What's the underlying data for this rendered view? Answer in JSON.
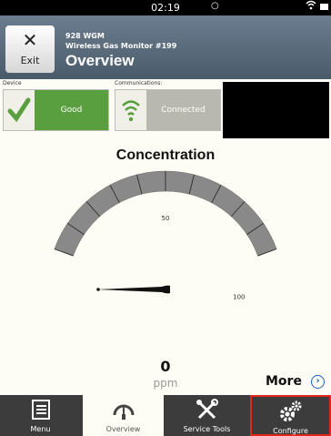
{
  "status_bar": {
    "time": "02:19",
    "signal_dot": "○",
    "wifi_icon": "wifi-icon",
    "battery_icon": "battery-icon"
  },
  "header": {
    "exit_label": "Exit",
    "device_model": "928 WGM",
    "device_name": "Wireless Gas Monitor #199",
    "title": "Overview"
  },
  "device": {
    "label": "Device",
    "status": "Good",
    "icon": "checkmark-icon",
    "status_color": "#5a9f3f"
  },
  "communications": {
    "label": "Communications:",
    "status": "Connected",
    "icon": "wifi-signal-icon",
    "status_color": "#b8b8b0"
  },
  "gauge": {
    "title": "Concentration",
    "min": 0,
    "max": 100,
    "tick_labels": [
      "50",
      "100"
    ],
    "needle_value": 0
  },
  "reading": {
    "value": "0",
    "unit": "ppm"
  },
  "more": {
    "label": "More",
    "icon": "chevron-right-circle-icon"
  },
  "tabs": [
    {
      "label": "Menu",
      "icon": "menu-list-icon",
      "active": false,
      "highlight": false
    },
    {
      "label": "Overview",
      "icon": "gauge-icon",
      "active": true,
      "highlight": false
    },
    {
      "label": "Service Tools",
      "icon": "tools-icon",
      "active": false,
      "highlight": false
    },
    {
      "label": "Configure",
      "icon": "gears-icon",
      "active": false,
      "highlight": true
    }
  ],
  "colors": {
    "accent_green": "#5a9f3f",
    "highlight_red": "#e1261c",
    "link_blue": "#1e5fbf"
  }
}
